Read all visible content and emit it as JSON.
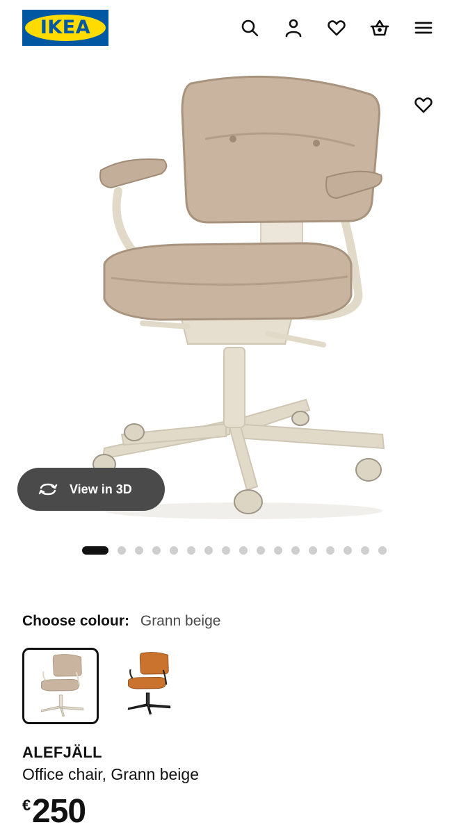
{
  "header": {
    "logo_text": "IKEA",
    "icons": [
      "search-icon",
      "user-icon",
      "heart-icon",
      "basket-icon",
      "menu-icon"
    ]
  },
  "colors": {
    "ikea_blue": "#0058a3",
    "ikea_yellow": "#ffdb00",
    "beige_leather": "#c8b49f",
    "frame_beige": "#e2dac9",
    "orange_leather": "#c9732e",
    "pill_bg": "#4a4a4a"
  },
  "gallery": {
    "view_3d_label": "View in 3D",
    "slide_count": 17,
    "active_slide": 1
  },
  "colour": {
    "label": "Choose colour:",
    "selected": "Grann beige",
    "options": [
      "Grann beige",
      "Grann orange-brown"
    ]
  },
  "product": {
    "name": "ALEFJÄLL",
    "description": "Office chair, Grann beige",
    "currency": "€",
    "price": "250"
  }
}
